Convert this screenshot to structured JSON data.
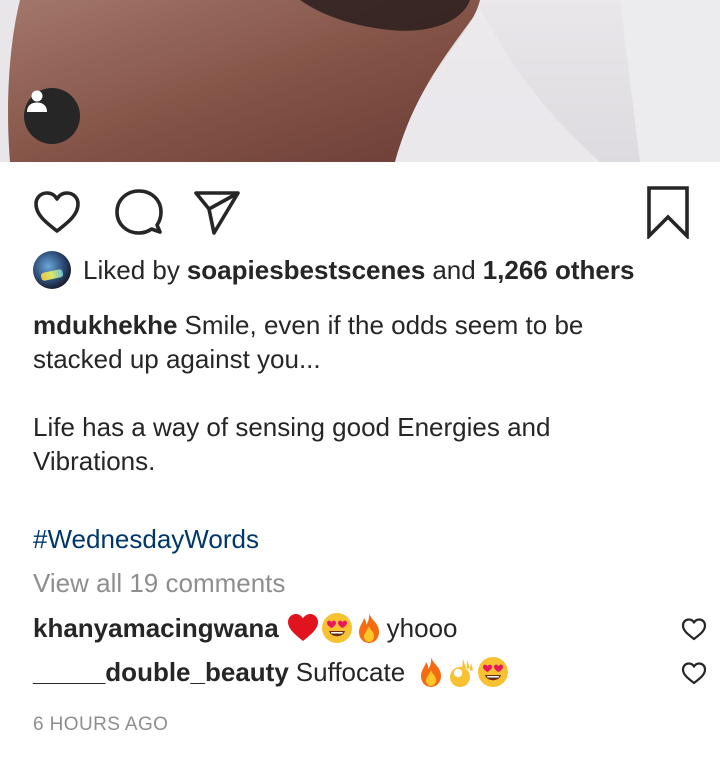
{
  "post": {
    "tag_icon": "user-tag-icon",
    "actions": {
      "like_icon": "heart-outline-icon",
      "comment_icon": "comment-bubble-icon",
      "share_icon": "paper-plane-icon",
      "save_icon": "bookmark-icon"
    },
    "likes": {
      "prefix": "Liked by",
      "user": "soapiesbestscenes",
      "conjunction": "and",
      "others": "1,266 others"
    },
    "caption": {
      "username": "mdukhekhe",
      "lines": [
        "Smile, even if the odds seem to be",
        "stacked up against you...",
        "",
        "Life has a way of sensing good Energies and",
        "Vibrations.",
        ""
      ],
      "hashtag": "#WednesdayWords"
    },
    "view_all_comments": "View all 19 comments",
    "comments": [
      {
        "username": "khanyamacingwana",
        "emojis": [
          "red-heart",
          "heart-eyes",
          "fire"
        ],
        "text": "yhooo"
      },
      {
        "username": "_____double_beauty",
        "text": "Suffocate",
        "emojis": [
          "fire",
          "ok-hand",
          "heart-eyes"
        ]
      }
    ],
    "timestamp": "6 HOURS AGO"
  },
  "colors": {
    "text": "#262626",
    "muted": "#8e8e8e",
    "hashtag": "#00376b",
    "heart_red": "#ed1c24"
  }
}
